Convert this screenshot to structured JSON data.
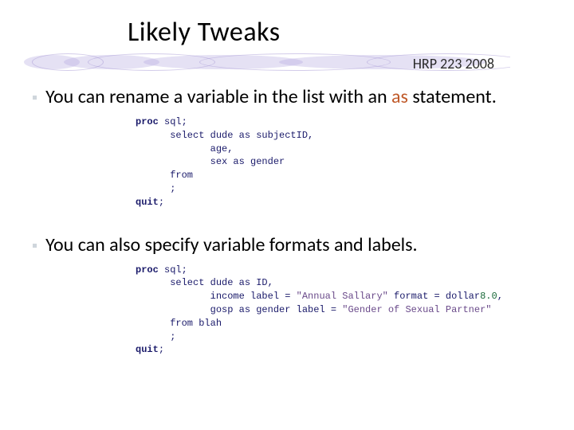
{
  "title": "Likely Tweaks",
  "header_label": "HRP 223 2008",
  "bullets": [
    {
      "pre": "You can rename a variable in the list with an ",
      "kw": "as",
      "post": " statement."
    },
    {
      "pre": "You can also specify variable formats and labels.",
      "kw": "",
      "post": ""
    }
  ],
  "code1": {
    "l1a": "proc",
    "l1b": " sql;",
    "l2": "      select dude as subjectID,",
    "l3": "             age,",
    "l4": "             sex as gender",
    "l5": "      from",
    "l6": "      ;",
    "l7a": "quit",
    "l7b": ";"
  },
  "code2": {
    "l1a": "proc",
    "l1b": " sql;",
    "l2": "      select dude as ID,",
    "l3a": "             income label = ",
    "l3b": "\"Annual Sallary\"",
    "l3c": " format = dollar",
    "l3d": "8.0",
    "l3e": ",",
    "l4a": "             gosp as gender label = ",
    "l4b": "\"Gender of Sexual Partner\"",
    "l5": "      from blah",
    "l6": "      ;",
    "l7a": "quit",
    "l7b": ";"
  }
}
